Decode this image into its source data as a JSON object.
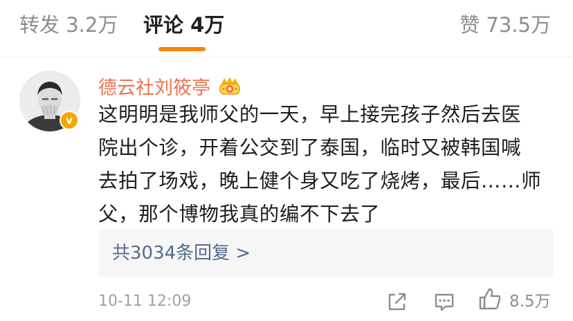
{
  "tabs": {
    "repost": "转发 3.2万",
    "comment": "评论 4万",
    "like": "赞 73.5万"
  },
  "comment": {
    "username": "德云社刘筱亭",
    "verified_icon": "verified-v-icon",
    "verified_label": "v",
    "badge_icon": "crown-badge-icon",
    "text_lines": [
      "这明明是我师父的一天，早上接完孩子然后去医",
      "院出个诊，开着公交到了泰国，临时又被韩国喊",
      "去拍了场戏，晚上健个身又吃了烧烤，最后……师",
      "父，那个博物我真的编不下去了"
    ],
    "replies_label": "共3034条回复 >",
    "timestamp": "10-11 12:09",
    "like_count": "8.5万"
  },
  "colors": {
    "accent": "#ff8200",
    "username": "#eb7350",
    "link": "#536b8e",
    "muted": "#8d8d8d"
  }
}
